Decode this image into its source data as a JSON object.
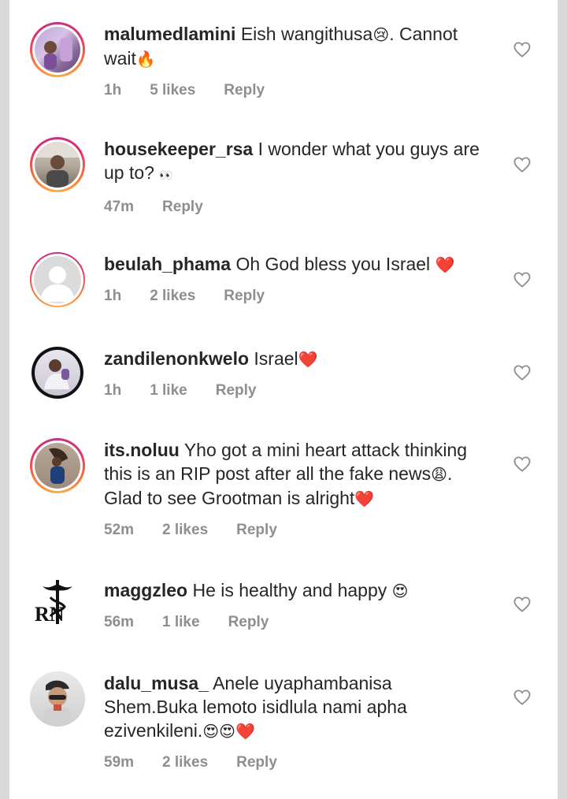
{
  "comments": [
    {
      "username": "malumedlamini",
      "text": "Eish wangithusa",
      "emoji1": "😢",
      "text2": ". Cannot wait",
      "emoji2": "🔥",
      "time": "1h",
      "likes": "5 likes",
      "reply": "Reply"
    },
    {
      "username": "housekeeper_rsa",
      "text": "I wonder what you guys are up to?",
      "emoji1": "👀",
      "time": "47m",
      "reply": "Reply"
    },
    {
      "username": "beulah_phama",
      "text": "Oh God bless you Israel",
      "emoji1": "❤️",
      "time": "1h",
      "likes": "2 likes",
      "reply": "Reply"
    },
    {
      "username": "zandilenonkwelo",
      "text": "Israel",
      "emoji1": "❤️",
      "time": "1h",
      "likes": "1 like",
      "reply": "Reply"
    },
    {
      "username": "its.noluu",
      "text": "Yho got a mini heart attack thinking this is an RIP post after all the fake news",
      "emoji1": "😩",
      "text2": ". Glad to see Grootman is alright",
      "emoji2": "❤️",
      "time": "52m",
      "likes": "2 likes",
      "reply": "Reply"
    },
    {
      "username": "maggzleo",
      "text": "He is healthy and happy",
      "emoji1": "😍",
      "time": "56m",
      "likes": "1 like",
      "reply": "Reply",
      "avatar_text": "RN"
    },
    {
      "username": "dalu_musa_",
      "text": "Anele uyaphambanisa Shem.Buka lemoto isidlula nami apha ezivenkileni.",
      "emoji1": "😍😍❤️",
      "time": "59m",
      "likes": "2 likes",
      "reply": "Reply"
    }
  ],
  "icons": {
    "like": "heart-outline-icon"
  },
  "colors": {
    "username": "#262626",
    "meta": "#8e8e8e",
    "heart_red": "#ed1c24"
  }
}
